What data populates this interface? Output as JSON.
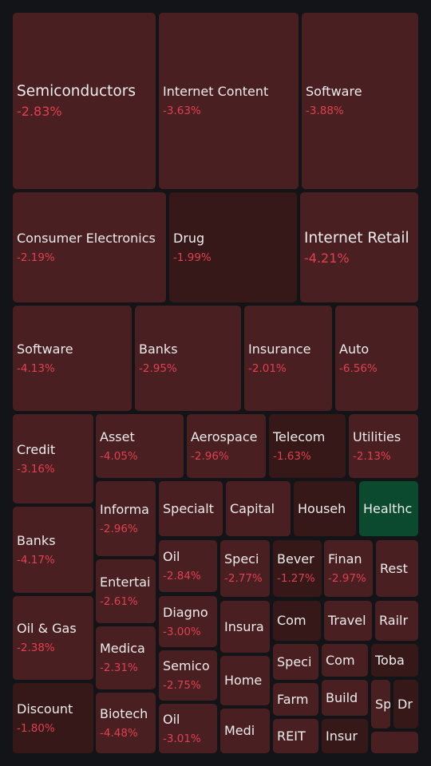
{
  "colors": {
    "background": "#121417",
    "down": "#4a1f22",
    "down_dark": "#361819",
    "up": "#0c4a30",
    "pct_text": "#e0404f"
  },
  "tiles": [
    {
      "label": "Semiconductors",
      "change": "-2.83%"
    },
    {
      "label": "Internet Content",
      "change": "-3.63%"
    },
    {
      "label": "Software",
      "change": "-3.88%"
    },
    {
      "label": "Consumer Electronics",
      "change": "-2.19%"
    },
    {
      "label": "Drug",
      "change": "-1.99%"
    },
    {
      "label": "Internet Retail",
      "change": "-4.21%"
    },
    {
      "label": "Software",
      "change": "-4.13%"
    },
    {
      "label": "Banks",
      "change": "-2.95%"
    },
    {
      "label": "Insurance",
      "change": "-2.01%"
    },
    {
      "label": "Auto",
      "change": "-6.56%"
    },
    {
      "label": "Credit",
      "change": "-3.16%"
    },
    {
      "label": "Banks",
      "change": "-4.17%"
    },
    {
      "label": "Oil & Gas",
      "change": "-2.38%"
    },
    {
      "label": "Discount",
      "change": "-1.80%"
    },
    {
      "label": "Asset",
      "change": "-4.05%"
    },
    {
      "label": "Aerospace",
      "change": "-2.96%"
    },
    {
      "label": "Telecom",
      "change": "-1.63%"
    },
    {
      "label": "Utilities",
      "change": "-2.13%"
    },
    {
      "label": "Informa",
      "change": "-2.96%"
    },
    {
      "label": "Entertai",
      "change": "-2.61%"
    },
    {
      "label": "Medica",
      "change": "-2.31%"
    },
    {
      "label": "Biotech",
      "change": "-4.48%"
    },
    {
      "label": "Specialt"
    },
    {
      "label": "Capital"
    },
    {
      "label": "Househ"
    },
    {
      "label": "Healthc"
    },
    {
      "label": "Oil",
      "change": "-2.84%"
    },
    {
      "label": "Diagno",
      "change": "-3.00%"
    },
    {
      "label": "Semico",
      "change": "-2.75%"
    },
    {
      "label": "Oil",
      "change": "-3.01%"
    },
    {
      "label": "Speci",
      "change": "-2.77%"
    },
    {
      "label": "Bever",
      "change": "-1.27%"
    },
    {
      "label": "Finan",
      "change": "-2.97%"
    },
    {
      "label": "Rest"
    },
    {
      "label": "Insura"
    },
    {
      "label": "Home"
    },
    {
      "label": "Medi"
    },
    {
      "label": "Com"
    },
    {
      "label": "Travel"
    },
    {
      "label": "Railr"
    },
    {
      "label": "Speci"
    },
    {
      "label": "Com"
    },
    {
      "label": "Toba"
    },
    {
      "label": "Farm"
    },
    {
      "label": "Build"
    },
    {
      "label": "Sp"
    },
    {
      "label": "Dr"
    },
    {
      "label": "REIT"
    },
    {
      "label": "Insur"
    },
    {
      "label": ""
    }
  ]
}
